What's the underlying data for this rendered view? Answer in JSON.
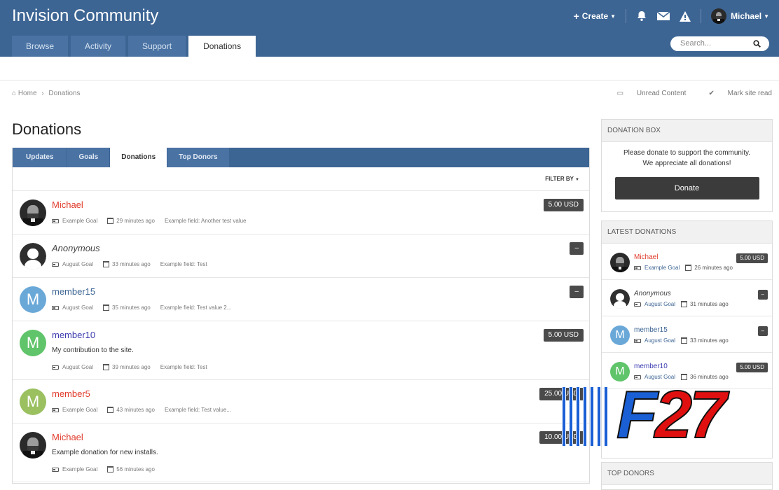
{
  "header": {
    "site_title": "Invision Community",
    "create_label": "Create",
    "user_name": "Michael",
    "nav_tabs": [
      {
        "label": "Browse"
      },
      {
        "label": "Activity"
      },
      {
        "label": "Support"
      },
      {
        "label": "Donations"
      }
    ],
    "search_placeholder": "Search..."
  },
  "breadcrumb": {
    "home": "Home",
    "current": "Donations"
  },
  "top_links": {
    "unread": "Unread Content",
    "mark_read": "Mark site read"
  },
  "page_title": "Donations",
  "sub_tabs": [
    {
      "label": "Updates"
    },
    {
      "label": "Goals"
    },
    {
      "label": "Donations"
    },
    {
      "label": "Top Donors"
    }
  ],
  "filter_label": "FILTER BY",
  "donations": [
    {
      "name": "Michael",
      "name_color": "#e03a2a",
      "italic": false,
      "avatar": "portrait",
      "desc": "",
      "goal": "Example Goal",
      "time": "29 minutes ago",
      "field": "Example field: Another test value",
      "amount": "5.00 USD"
    },
    {
      "name": "Anonymous",
      "name_color": "#444444",
      "italic": true,
      "avatar": "anonymous",
      "desc": "",
      "goal": "August Goal",
      "time": "33 minutes ago",
      "field": "Example field: Test",
      "amount": "–"
    },
    {
      "name": "member15",
      "name_color": "#3d6594",
      "italic": false,
      "avatar": "M",
      "avatar_color": "#6aa8d8",
      "desc": "",
      "goal": "August Goal",
      "time": "35 minutes ago",
      "field": "Example field: Test value 2...",
      "amount": "–"
    },
    {
      "name": "member10",
      "name_color": "#3b3bb0",
      "italic": false,
      "avatar": "M",
      "avatar_color": "#5fc46a",
      "desc": "My contribution to the site.",
      "goal": "August Goal",
      "time": "39 minutes ago",
      "field": "Example field: Test",
      "amount": "5.00 USD"
    },
    {
      "name": "member5",
      "name_color": "#e03a2a",
      "italic": false,
      "avatar": "M",
      "avatar_color": "#9ac060",
      "desc": "",
      "goal": "Example Goal",
      "time": "43 minutes ago",
      "field": "Example field: Test value...",
      "amount": "25.00 USD"
    },
    {
      "name": "Michael",
      "name_color": "#e03a2a",
      "italic": false,
      "avatar": "portrait",
      "desc": "Example donation for new installs.",
      "goal": "Example Goal",
      "time": "56 minutes ago",
      "field": "",
      "amount": "10.00 USD"
    }
  ],
  "donation_box": {
    "title": "Donation Box",
    "line1": "Please donate to support the community.",
    "line2": "We appreciate all donations!",
    "button": "Donate"
  },
  "latest": {
    "title": "Latest Donations",
    "items": [
      {
        "name": "Michael",
        "name_color": "#e03a2a",
        "italic": false,
        "avatar": "portrait",
        "goal": "Example Goal",
        "time": "26 minutes ago",
        "amount": "5.00 USD"
      },
      {
        "name": "Anonymous",
        "name_color": "#444444",
        "italic": true,
        "avatar": "anonymous",
        "goal": "August Goal",
        "time": "31 minutes ago",
        "amount": "–"
      },
      {
        "name": "member15",
        "name_color": "#3d6594",
        "italic": false,
        "avatar": "M",
        "avatar_color": "#6aa8d8",
        "goal": "August Goal",
        "time": "33 minutes ago",
        "amount": "–"
      },
      {
        "name": "member10",
        "name_color": "#3b3bb0",
        "italic": false,
        "avatar": "M",
        "avatar_color": "#5fc46a",
        "goal": "August Goal",
        "time": "36 minutes ago",
        "amount": "5.00 USD"
      }
    ]
  },
  "top_donors_title": "Top Donors",
  "watermark": "F27",
  "colors": {
    "header_bg": "#3d6594",
    "badge_bg": "#4a4a4a",
    "button_bg": "#3b3b3b"
  },
  "icons": [
    "plus-icon",
    "bell-icon",
    "envelope-icon",
    "warning-icon",
    "search-icon",
    "home-icon",
    "unread-icon",
    "check-icon",
    "goal-icon",
    "calendar-icon",
    "caret-down-icon"
  ]
}
